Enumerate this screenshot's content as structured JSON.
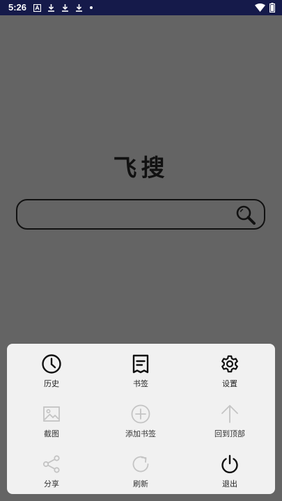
{
  "status_bar": {
    "time": "5:26",
    "icons": [
      "notification-a-icon",
      "download-icon",
      "download-icon",
      "download-icon",
      "dot-icon",
      "wifi-icon",
      "battery-icon"
    ]
  },
  "app": {
    "logo_text": "飞搜"
  },
  "search": {
    "value": "",
    "placeholder": ""
  },
  "menu": {
    "items": [
      {
        "label": "历史",
        "icon": "clock-icon",
        "enabled": true
      },
      {
        "label": "书签",
        "icon": "bookmark-list-icon",
        "enabled": true
      },
      {
        "label": "设置",
        "icon": "gear-icon",
        "enabled": true
      },
      {
        "label": "截图",
        "icon": "image-icon",
        "enabled": false
      },
      {
        "label": "添加书签",
        "icon": "plus-circle-icon",
        "enabled": false
      },
      {
        "label": "回到顶部",
        "icon": "arrow-up-icon",
        "enabled": false
      },
      {
        "label": "分享",
        "icon": "share-icon",
        "enabled": false
      },
      {
        "label": "刷新",
        "icon": "refresh-icon",
        "enabled": false
      },
      {
        "label": "退出",
        "icon": "power-icon",
        "enabled": true
      }
    ]
  },
  "colors": {
    "status_bar_bg": "#151a4a",
    "overlay_bg": "#646464",
    "menu_bg": "#f1f1f1",
    "icon_enabled": "#111111",
    "icon_disabled": "#c4c4c4"
  }
}
